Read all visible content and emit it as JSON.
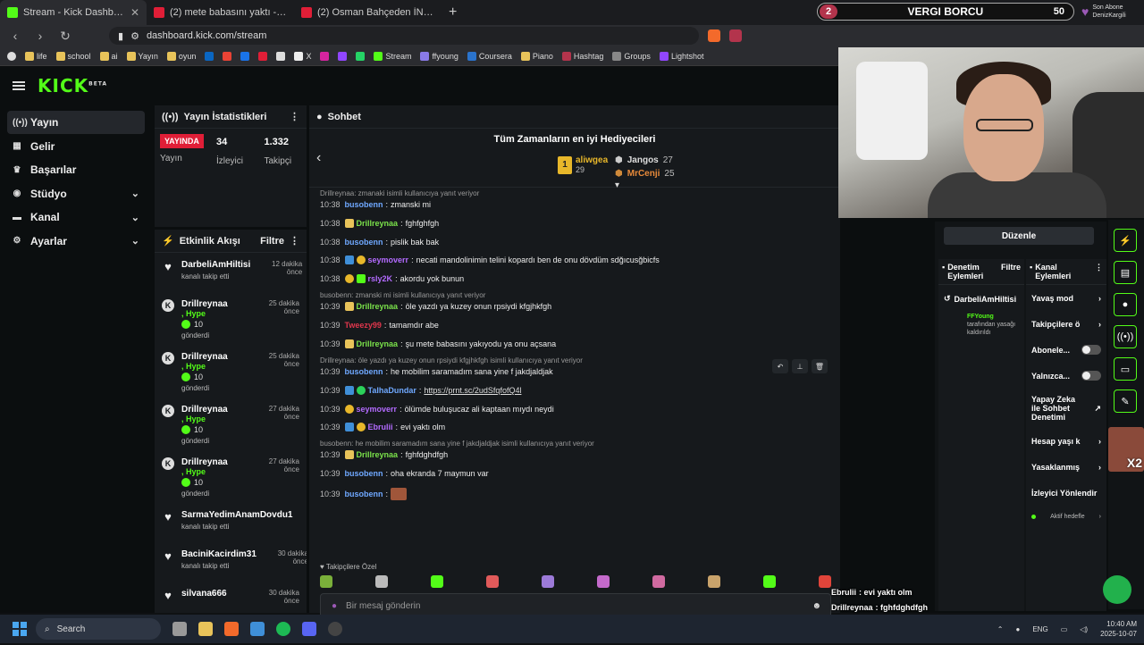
{
  "browser": {
    "tabs": [
      {
        "title": "Stream - Kick Dashboard",
        "color": "#53fc18",
        "active": true
      },
      {
        "title": "(2) mete babasını yaktı - YouTube",
        "color": "#e01e37",
        "active": false
      },
      {
        "title": "(2) Osman Bahçeden İNCİR Çalıyor -",
        "color": "#e01e37",
        "active": false
      }
    ],
    "url": "dashboard.kick.com/stream",
    "bookmarks": [
      "life",
      "school",
      "ai",
      "Yayın",
      "oyun",
      "X",
      "Stream",
      "ffyoung",
      "Coursera",
      "Piano",
      "Hashtag",
      "Groups",
      "Lightshot"
    ]
  },
  "overlay": {
    "counter_num": "2",
    "title": "VERGI BORCU",
    "value": "50",
    "sub_label": "Son Abone",
    "sub_name": "DenizKargili"
  },
  "sidenav": {
    "items": [
      {
        "label": "Yayın",
        "icon": "broadcast-icon",
        "glyph": "((•))",
        "active": true,
        "chev": ""
      },
      {
        "label": "Gelir",
        "icon": "revenue-icon",
        "glyph": "▦",
        "active": false,
        "chev": ""
      },
      {
        "label": "Başarılar",
        "icon": "trophy-icon",
        "glyph": "🏆",
        "active": false,
        "chev": ""
      },
      {
        "label": "Stüdyo",
        "icon": "studio-icon",
        "glyph": "◉",
        "active": false,
        "chev": "⌄"
      },
      {
        "label": "Kanal",
        "icon": "channel-icon",
        "glyph": "▬",
        "active": false,
        "chev": "⌄"
      },
      {
        "label": "Ayarlar",
        "icon": "gear-icon",
        "glyph": "⚙",
        "active": false,
        "chev": "⌄"
      }
    ]
  },
  "stats": {
    "title": "Yayın İstatistikleri",
    "live_label": "YAYINDA",
    "live_sub": "Yayın",
    "viewers": "34",
    "viewers_label": "İzleyici",
    "followers": "1.332",
    "followers_label": "Takipçi"
  },
  "feed": {
    "title": "Etkinlik Akışı",
    "filter": "Filtre",
    "items": [
      {
        "type": "follow",
        "name": "DarbeliAmHiltisi",
        "sub": "kanalı takip etti",
        "time": "12 dakika önce"
      },
      {
        "type": "gift",
        "name": "Drillreynaa",
        "hype": ", Hype",
        "amount": "10",
        "sub": "gönderdi",
        "time": "25 dakika önce"
      },
      {
        "type": "gift",
        "name": "Drillreynaa",
        "hype": ", Hype",
        "amount": "10",
        "sub": "gönderdi",
        "time": "25 dakika önce"
      },
      {
        "type": "gift",
        "name": "Drillreynaa",
        "hype": ", Hype",
        "amount": "10",
        "sub": "gönderdi",
        "time": "27 dakika önce"
      },
      {
        "type": "gift",
        "name": "Drillreynaa",
        "hype": ", Hype",
        "amount": "10",
        "sub": "gönderdi",
        "time": "27 dakika önce"
      },
      {
        "type": "follow",
        "name": "SarmaYedimAnamDovdu1",
        "sub": "kanalı takip etti",
        "time": "dakika önce"
      },
      {
        "type": "follow",
        "name": "BaciniKacirdim31",
        "sub": "kanalı takip etti",
        "time": "30 dakika önce"
      },
      {
        "type": "follow",
        "name": "silvana666",
        "sub": "",
        "time": "30 dakika önce"
      }
    ]
  },
  "chat": {
    "title": "Sohbet",
    "gifters_title": "Tüm Zamanların en iyi Hediyecileri",
    "top1": {
      "name": "aliwgea",
      "value": "29",
      "rank": "1"
    },
    "top2": {
      "name": "Jangos",
      "value": "27"
    },
    "top3": {
      "name": "MrCenji",
      "value": "25"
    },
    "messages": [
      {
        "kind": "reply",
        "text": "Drillreynaa: zmanaki isimli kullanıcıya yanıt veriyor"
      },
      {
        "kind": "msg",
        "ts": "10:38",
        "user": "busobenn",
        "color": "#6fa8ff",
        "badges": [],
        "text": "zmanski mi"
      },
      {
        "kind": "msg",
        "ts": "10:38",
        "user": "Drillreynaa",
        "color": "#7ae14a",
        "badges": [
          "sub"
        ],
        "text": "fghfghfgh"
      },
      {
        "kind": "msg",
        "ts": "10:38",
        "user": "busobenn",
        "color": "#6fa8ff",
        "badges": [],
        "text": "pislik bak bak"
      },
      {
        "kind": "msg",
        "ts": "10:38",
        "user": "seymoverr",
        "color": "#b36bff",
        "badges": [
          "vip",
          "coin"
        ],
        "text": "necati mandolinimin telini kopardı ben de onu dövdüm sdğıcusğbicfs"
      },
      {
        "kind": "msg",
        "ts": "10:38",
        "user": "rsly2K",
        "color": "#b36bff",
        "badges": [
          "coin",
          "mod"
        ],
        "text": "akordu yok bunun"
      },
      {
        "kind": "reply",
        "text": "busobenn: zmanski mi isimli kullanıcıya yanıt veriyor"
      },
      {
        "kind": "msg",
        "ts": "10:39",
        "user": "Drillreynaa",
        "color": "#7ae14a",
        "badges": [
          "sub"
        ],
        "text": "öle yazdı ya kuzey onun rpsiydi kfgjhkfgh"
      },
      {
        "kind": "msg",
        "ts": "10:39",
        "user": "Tweezy99",
        "color": "#e0364c",
        "badges": [],
        "text": "tamamdır abe"
      },
      {
        "kind": "msg",
        "ts": "10:39",
        "user": "Drillreynaa",
        "color": "#7ae14a",
        "badges": [
          "sub"
        ],
        "text": "şu mete babasını yakıyodu ya onu açsana"
      },
      {
        "kind": "reply",
        "text": "Drillreynaa: öle yazdı ya kuzey onun rpsiydi kfgjhkfgh isimli kullanıcıya yanıt veriyor"
      },
      {
        "kind": "msg",
        "ts": "10:39",
        "user": "busobenn",
        "color": "#6fa8ff",
        "badges": [],
        "text": "he mobilim saramadım sana yine f jakdjaldjak"
      },
      {
        "kind": "msg",
        "ts": "10:39",
        "user": "TalhaDundar",
        "color": "#6fa8ff",
        "badges": [
          "vip",
          "ver"
        ],
        "text": "https://prnt.sc/2udSfqfofQ4l",
        "link": true
      },
      {
        "kind": "msg",
        "ts": "10:39",
        "user": "seymoverr",
        "color": "#b36bff",
        "badges": [
          "coin"
        ],
        "text": "ölümde buluşucaz ali kaptaan mıydı neydi"
      },
      {
        "kind": "msg",
        "ts": "10:39",
        "user": "Ebrulii",
        "color": "#b36bff",
        "badges": [
          "vip",
          "coin"
        ],
        "text": "evi yaktı olm"
      },
      {
        "kind": "reply",
        "text": "busobenn: he mobilim saramadım sana yine f jakdjaldjak isimli kullanıcıya yanıt veriyor"
      },
      {
        "kind": "msg",
        "ts": "10:39",
        "user": "Drillreynaa",
        "color": "#7ae14a",
        "badges": [
          "sub"
        ],
        "text": "fghfdghdfgh"
      },
      {
        "kind": "msg",
        "ts": "10:39",
        "user": "busobenn",
        "color": "#6fa8ff",
        "badges": [],
        "text": "oha ekranda 7 maymun var"
      },
      {
        "kind": "msg",
        "ts": "10:39",
        "user": "busobenn",
        "color": "#6fa8ff",
        "badges": [],
        "text": "",
        "emote": true
      }
    ],
    "followers_only": "Takipçilere Özel",
    "input_placeholder": "Bir mesaj gönderin"
  },
  "modpanel": {
    "edit": "Düzenle",
    "mod_title": "Denetim Eylemleri",
    "mod_filter": "Filtre",
    "mod_user": "DarbeliAmHiltisi",
    "mod_actor": "FFYoung",
    "mod_desc": "tarafından yasağı kaldırıldı",
    "chan_title": "Kanal Eylemleri",
    "chan_items": [
      {
        "label": "Yavaş mod",
        "ctl": "›"
      },
      {
        "label": "Takipçilere ö",
        "ctl": "›"
      },
      {
        "label": "Abonele...",
        "ctl": "toggle"
      },
      {
        "label": "Yalnızca...",
        "ctl": "toggle"
      },
      {
        "label": "Yapay Zeka ile Sohbet Denetimi",
        "ctl": "↗"
      },
      {
        "label": "Hesap yaşı k",
        "ctl": "›"
      },
      {
        "label": "Yasaklanmış",
        "ctl": "›"
      },
      {
        "label": "İzleyici Yönlendir",
        "ctl": ""
      }
    ],
    "goals": "Aktif hedefle"
  },
  "overlay_chat": [
    {
      "user": "Ebrulii",
      "text": ": evi yaktı olm"
    },
    {
      "user": "Drillreynaa",
      "text": ": fghfdghdfgh"
    },
    {
      "user": "busobenn",
      "text": ": oha ekranda 7 maymun var"
    },
    {
      "user": "busobenn",
      "text": ":"
    }
  ],
  "avatar_badge": "X2",
  "taskbar": {
    "search": "Search",
    "lang": "ENG",
    "time": "10:40 AM",
    "date": "2025-10-07"
  }
}
